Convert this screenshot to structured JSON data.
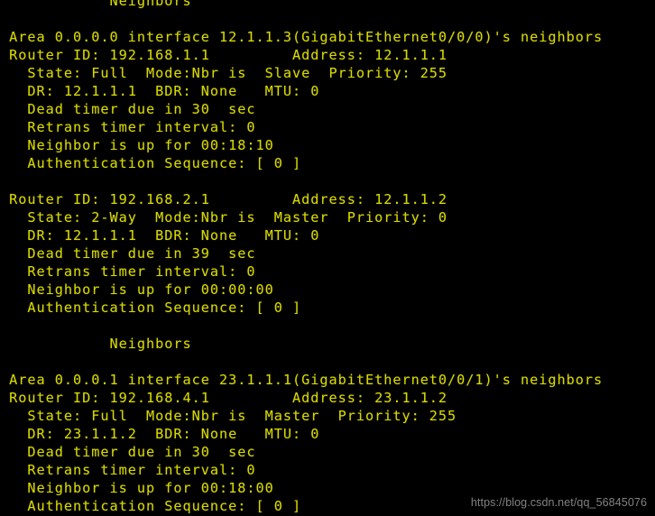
{
  "terminal": {
    "foreground_color": "#d8d800",
    "background_color": "#000000",
    "lines": [
      "            Neighbors",
      "",
      " Area 0.0.0.0 interface 12.1.1.3(GigabitEthernet0/0/0)'s neighbors",
      " Router ID: 192.168.1.1         Address: 12.1.1.1",
      "   State: Full  Mode:Nbr is  Slave  Priority: 255",
      "   DR: 12.1.1.1  BDR: None   MTU: 0",
      "   Dead timer due in 30  sec",
      "   Retrans timer interval: 0",
      "   Neighbor is up for 00:18:10",
      "   Authentication Sequence: [ 0 ]",
      "",
      " Router ID: 192.168.2.1         Address: 12.1.1.2",
      "   State: 2-Way  Mode:Nbr is  Master  Priority: 0",
      "   DR: 12.1.1.1  BDR: None   MTU: 0",
      "   Dead timer due in 39  sec",
      "   Retrans timer interval: 0",
      "   Neighbor is up for 00:00:00",
      "   Authentication Sequence: [ 0 ]",
      "",
      "            Neighbors",
      "",
      " Area 0.0.0.1 interface 23.1.1.1(GigabitEthernet0/0/1)'s neighbors",
      " Router ID: 192.168.4.1         Address: 23.1.1.2",
      "   State: Full  Mode:Nbr is  Master  Priority: 255",
      "   DR: 23.1.1.2  BDR: None   MTU: 0",
      "   Dead timer due in 30  sec",
      "   Retrans timer interval: 0",
      "   Neighbor is up for 00:18:00",
      "   Authentication Sequence: [ 0 ]"
    ]
  },
  "watermark": {
    "text": "https://blog.csdn.net/qq_56845076",
    "color": "#8a8a8a"
  }
}
